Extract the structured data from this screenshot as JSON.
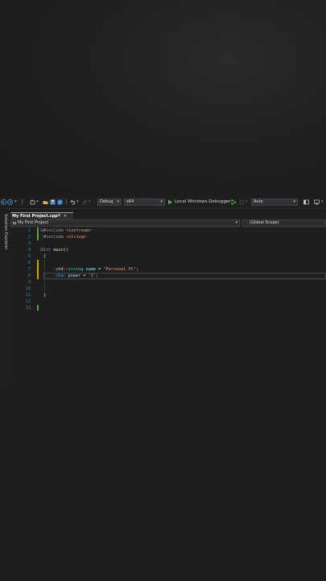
{
  "toolbar": {
    "config_label": "Debug",
    "platform_label": "x64",
    "run_label": "Local Windows Debugger",
    "auto_label": "Auto",
    "dropdown_arrow": "▾"
  },
  "sidebar": {
    "solution_explorer_label": "Solution Explorer"
  },
  "tab": {
    "title": "My First Project.cpp*",
    "pin": "⊣",
    "close": "✕"
  },
  "navbar": {
    "project": "My First Project",
    "scope": "(Global Scope)"
  },
  "editor": {
    "line_numbers": [
      "1",
      "2",
      "3",
      "4",
      "5",
      "6",
      "7",
      "8",
      "9",
      "10",
      "11",
      "12",
      "13"
    ],
    "line1": {
      "directive": "#include",
      "header": "<iostream>"
    },
    "line2": {
      "directive": "#include",
      "header": "<string>"
    },
    "line4": {
      "type": "int",
      "fn": "main",
      "parens": "()"
    },
    "line5": {
      "text": "{"
    },
    "line7": {
      "ns": "std",
      "sep": "::",
      "type": "string",
      "var": "name",
      "eq": " = ",
      "value": "\"Personal PC\"",
      "semi": ";"
    },
    "line8": {
      "type": "char",
      "var": "power",
      "eq": " = ",
      "value": "'I'",
      "semi": ";"
    },
    "line11": {
      "text": "}"
    }
  },
  "colors": {
    "keyword": "#569cd6",
    "string": "#d69d85",
    "line_number": "#2b91af",
    "changed": "#57a64a"
  }
}
